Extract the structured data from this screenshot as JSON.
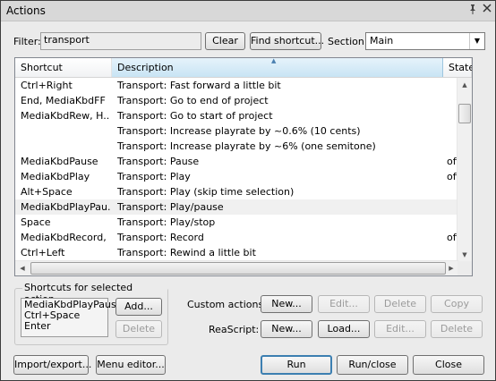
{
  "window": {
    "title": "Actions",
    "pin_icon": "pin-icon",
    "close_icon": "close-icon"
  },
  "filter": {
    "label": "Filter:",
    "value": "transport"
  },
  "buttons": {
    "clear": "Clear",
    "find_shortcut": "Find shortcut..."
  },
  "section": {
    "label": "Section:",
    "value": "Main"
  },
  "table": {
    "columns": [
      "Shortcut",
      "Description",
      "State"
    ],
    "rows": [
      {
        "shortcut": "Ctrl+Right",
        "description": "Transport: Fast forward a little bit",
        "state": ""
      },
      {
        "shortcut": "End, MediaKbdFF",
        "description": "Transport: Go to end of project",
        "state": ""
      },
      {
        "shortcut": "MediaKbdRew, H...",
        "description": "Transport: Go to start of project",
        "state": ""
      },
      {
        "shortcut": "",
        "description": "Transport: Increase playrate by ~0.6% (10 cents)",
        "state": ""
      },
      {
        "shortcut": "",
        "description": "Transport: Increase playrate by ~6% (one semitone)",
        "state": ""
      },
      {
        "shortcut": "MediaKbdPause",
        "description": "Transport: Pause",
        "state": "off"
      },
      {
        "shortcut": "MediaKbdPlay",
        "description": "Transport: Play",
        "state": "off"
      },
      {
        "shortcut": "Alt+Space",
        "description": "Transport: Play (skip time selection)",
        "state": ""
      },
      {
        "shortcut": "MediaKbdPlayPau...",
        "description": "Transport: Play/pause",
        "state": ""
      },
      {
        "shortcut": "Space",
        "description": "Transport: Play/stop",
        "state": ""
      },
      {
        "shortcut": "MediaKbdRecord, ...",
        "description": "Transport: Record",
        "state": "off"
      },
      {
        "shortcut": "Ctrl+Left",
        "description": "Transport: Rewind a little bit",
        "state": ""
      }
    ],
    "selected_index": 8
  },
  "shortcuts_panel": {
    "title": "Shortcuts for selected action",
    "items": [
      "MediaKbdPlayPause",
      "Ctrl+Space",
      "Enter"
    ],
    "add": "Add...",
    "delete": "Delete"
  },
  "custom_actions": {
    "label": "Custom actions:",
    "new": "New...",
    "edit": "Edit...",
    "delete": "Delete",
    "copy": "Copy"
  },
  "reascript": {
    "label": "ReaScript:",
    "new": "New...",
    "load": "Load...",
    "edit": "Edit...",
    "delete": "Delete"
  },
  "footer": {
    "import_export": "Import/export...",
    "menu_editor": "Menu editor...",
    "run": "Run",
    "run_close": "Run/close",
    "close": "Close"
  }
}
